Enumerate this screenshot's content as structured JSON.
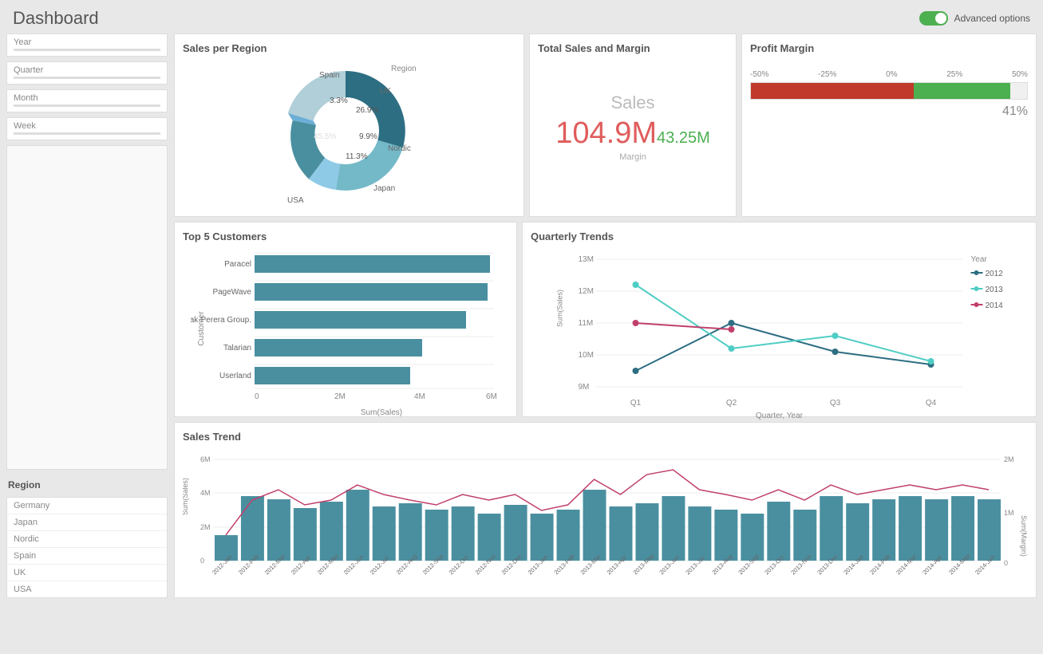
{
  "header": {
    "title": "Dashboard",
    "advanced_options_label": "Advanced options"
  },
  "sidebar": {
    "filters": [
      {
        "label": "Year"
      },
      {
        "label": "Quarter"
      },
      {
        "label": "Month"
      },
      {
        "label": "Week"
      }
    ],
    "region_label": "Region",
    "regions": [
      "Germany",
      "Japan",
      "Nordic",
      "Spain",
      "UK",
      "USA"
    ]
  },
  "sales_per_region": {
    "title": "Sales per Region",
    "legend_label": "Region",
    "segments": [
      {
        "label": "Spain",
        "value": 3.3,
        "color": "#6baed6"
      },
      {
        "label": "UK",
        "value": 26.9,
        "color": "#74b9c8"
      },
      {
        "label": "Nordic",
        "value": 9.9,
        "color": "#8ecae6"
      },
      {
        "label": "Japan",
        "value": 11.3,
        "color": "#4a8fa0"
      },
      {
        "label": "USA",
        "value": 45.5,
        "color": "#2d6e82"
      },
      {
        "label": "",
        "value": 3.1,
        "color": "#b0cfd8"
      }
    ]
  },
  "total_sales": {
    "title": "Total Sales and Margin",
    "sales_label": "Sales",
    "sales_value": "104.9M",
    "margin_value": "43.25M",
    "margin_label": "Margin"
  },
  "profit_margin": {
    "title": "Profit Margin",
    "axis_labels": [
      "-50%",
      "-25%",
      "0%",
      "25%",
      "50%"
    ],
    "percentage": "41%"
  },
  "top_customers": {
    "title": "Top 5 Customers",
    "customers": [
      {
        "name": "Paracel",
        "value": 5.9,
        "max": 6
      },
      {
        "name": "PageWave",
        "value": 5.85,
        "max": 6
      },
      {
        "name": "Deak-Perera Group.",
        "value": 5.3,
        "max": 6
      },
      {
        "name": "Talarian",
        "value": 4.2,
        "max": 6
      },
      {
        "name": "Userland",
        "value": 3.9,
        "max": 6
      }
    ],
    "x_axis_labels": [
      "0",
      "2M",
      "4M",
      "6M"
    ],
    "x_label": "Sum(Sales)",
    "y_label": "Customer"
  },
  "quarterly_trends": {
    "title": "Quarterly Trends",
    "y_label": "Sum(Sales)",
    "x_label": "Quarter, Year",
    "y_axis": [
      "13M",
      "12M",
      "11M",
      "10M",
      "9M"
    ],
    "x_axis": [
      "Q1",
      "Q2",
      "Q3",
      "Q4"
    ],
    "legend_label": "Year",
    "series": [
      {
        "label": "2012",
        "color": "#2d6e82",
        "points": [
          9.5,
          11.0,
          10.1,
          9.7
        ]
      },
      {
        "label": "2013",
        "color": "#4ecdc4",
        "points": [
          12.2,
          10.2,
          10.6,
          9.8
        ]
      },
      {
        "label": "2014",
        "color": "#c0406b",
        "points": [
          11.0,
          10.8,
          null,
          null
        ]
      }
    ]
  },
  "sales_trend": {
    "title": "Sales Trend",
    "y_label": "Sum(Sales)",
    "y_right_label": "Sum(Margin)",
    "bar_color": "#4a8fa0",
    "line_color": "#c0406b",
    "x_labels": [
      "2012-Jan",
      "2012-Feb",
      "2012-Mar",
      "2012-Apr",
      "2012-May",
      "2012-Jun",
      "2012-Jul",
      "2012-Aug",
      "2012-Sep",
      "2012-Oct",
      "2012-Nov",
      "2012-Dec",
      "2013-Jan",
      "2013-Feb",
      "2013-Mar",
      "2013-Apr",
      "2013-May",
      "2013-Jun",
      "2013-Jul",
      "2013-Aug",
      "2013-Sep",
      "2013-Oct",
      "2013-Nov",
      "2013-Dec",
      "2014-Jan",
      "2014-Feb",
      "2014-Mar",
      "2014-Apr",
      "2014-May",
      "2014-Jun"
    ],
    "bar_values": [
      1.5,
      3.8,
      3.6,
      3.1,
      3.5,
      4.2,
      3.2,
      3.4,
      3.0,
      3.2,
      2.8,
      3.3,
      2.8,
      3.0,
      4.2,
      3.2,
      3.4,
      3.8,
      3.2,
      3.0,
      2.8,
      3.5,
      3.0,
      3.8,
      3.4,
      3.6,
      3.8,
      3.6,
      3.8,
      3.6
    ],
    "line_values": [
      0.5,
      1.2,
      1.4,
      1.1,
      1.2,
      1.5,
      1.3,
      1.2,
      1.1,
      1.3,
      1.2,
      1.3,
      1.0,
      1.1,
      1.6,
      1.3,
      1.7,
      1.8,
      1.4,
      1.3,
      1.2,
      1.4,
      1.2,
      1.5,
      1.3,
      1.4,
      1.5,
      1.4,
      1.5,
      1.4
    ],
    "y_axis": [
      "6M",
      "4M",
      "2M",
      "0"
    ],
    "y_right_axis": [
      "2M",
      "1M",
      "0"
    ]
  }
}
